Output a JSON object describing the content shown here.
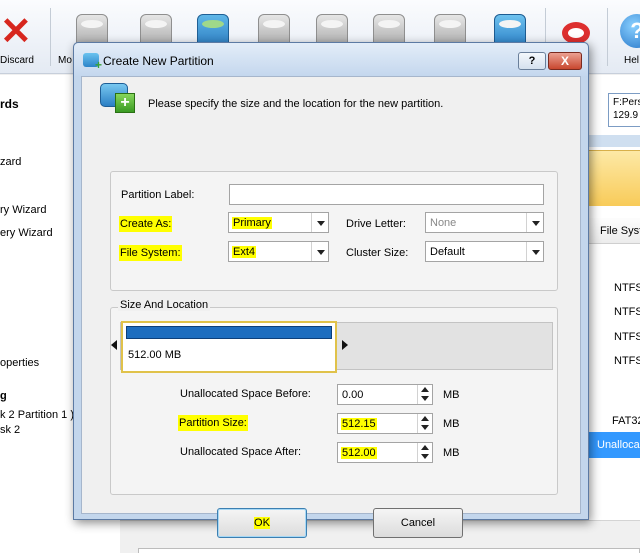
{
  "toolbar": {
    "discard_label": "Discard",
    "mo_label": "Mo",
    "help_label": "Hel"
  },
  "left_panel": {
    "items": [
      "rds",
      "zard",
      "ry Wizard",
      "ery Wizard",
      "operties",
      "g",
      "k 2 Partition 1 )",
      "sk 2"
    ]
  },
  "right_panel": {
    "disk_line1": "F:Pers",
    "disk_line2": "129.9",
    "column_header": "File Syst",
    "fs_values": [
      "NTFS",
      "NTFS",
      "NTFS",
      "NTFS",
      "FAT32"
    ],
    "unallocated": "Unalloca"
  },
  "dialog": {
    "title": "Create New Partition",
    "help_button": "?",
    "close_button": "X",
    "header_text": "Please specify the size and the location for the new partition.",
    "partition_label": {
      "label": "Partition Label:",
      "value": ""
    },
    "create_as": {
      "label": "Create As:",
      "value": "Primary"
    },
    "drive_letter": {
      "label": "Drive Letter:",
      "value": "None"
    },
    "file_system": {
      "label": "File System:",
      "value": "Ext4"
    },
    "cluster_size": {
      "label": "Cluster Size:",
      "value": "Default"
    },
    "size_group_title": "Size And Location",
    "partition_block_size": "512.00 MB",
    "unallocated_before": {
      "label": "Unallocated Space Before:",
      "value": "0.00",
      "unit": "MB"
    },
    "partition_size": {
      "label": "Partition Size:",
      "value": "512.15",
      "unit": "MB"
    },
    "unallocated_after": {
      "label": "Unallocated Space After:",
      "value": "512.00",
      "unit": "MB"
    },
    "ok_button": "OK",
    "cancel_button": "Cancel"
  },
  "colors": {
    "highlight": "#ffff00",
    "partition_bar": "#1d6dbf",
    "selection_row": "#3399ff"
  }
}
